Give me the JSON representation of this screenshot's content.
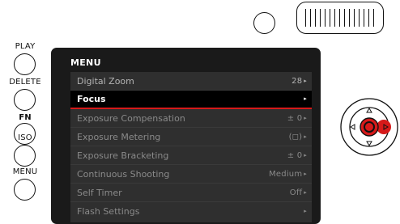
{
  "side_buttons": [
    {
      "label": "PLAY",
      "bold": false
    },
    {
      "label": "DELETE",
      "bold": false
    },
    {
      "label": "FN",
      "bold": true
    },
    {
      "label": "ISO",
      "bold": false
    },
    {
      "label": "MENU",
      "bold": false
    }
  ],
  "menu": {
    "title": "MENU",
    "items": [
      {
        "label": "Digital Zoom",
        "value": "28",
        "state": "active"
      },
      {
        "label": "Focus",
        "value": "",
        "state": "selected"
      },
      {
        "label": "Exposure Compensation",
        "value": "± 0",
        "state": "dimmed"
      },
      {
        "label": "Exposure Metering",
        "value": "(◻)",
        "state": "dimmed"
      },
      {
        "label": "Exposure Bracketing",
        "value": "± 0",
        "state": "dimmed"
      },
      {
        "label": "Continuous Shooting",
        "value": "Medium",
        "state": "dimmed"
      },
      {
        "label": "Self Timer",
        "value": "Off",
        "state": "dimmed"
      },
      {
        "label": "Flash Settings",
        "value": "",
        "state": "dimmed"
      }
    ]
  },
  "colors": {
    "highlight": "#d61a1a",
    "screen_bg": "#1a1a1a",
    "list_bg": "#2f2f2f"
  },
  "icons": {
    "nav_center": "center-button-icon",
    "nav_right": "right-arrow-icon"
  }
}
